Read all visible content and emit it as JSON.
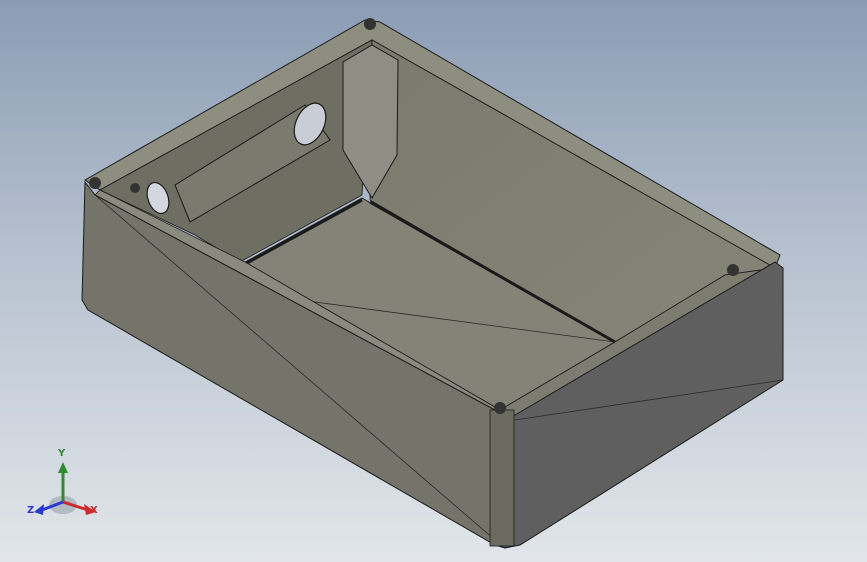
{
  "viewport": {
    "background_top": "#8b9cb4",
    "background_bottom": "#e2e6ea",
    "part_color": "#76766a"
  },
  "triad": {
    "x_label": "X",
    "y_label": "Y",
    "z_label": "Z",
    "x_color": "#cc2a2a",
    "y_color": "#2e8b2e",
    "z_color": "#2a3acc"
  }
}
